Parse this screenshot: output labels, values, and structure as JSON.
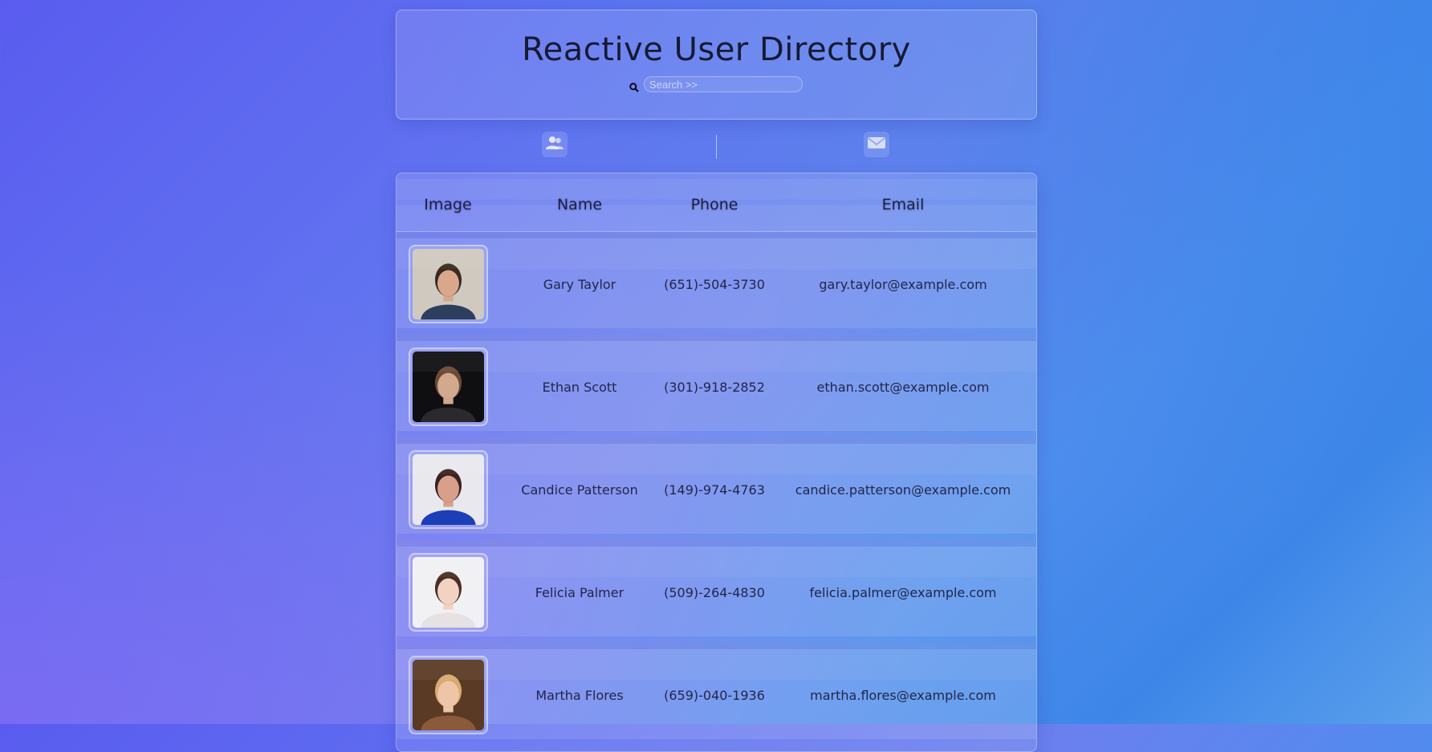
{
  "header": {
    "title": "Reactive User Directory",
    "search_placeholder": "Search >>"
  },
  "icons": {
    "search": "search-icon",
    "users": "users-icon",
    "mail": "mail-icon"
  },
  "table": {
    "columns": [
      "Image",
      "Name",
      "Phone",
      "Email"
    ],
    "rows": [
      {
        "name": "Gary Taylor",
        "phone": "(651)-504-3730",
        "email": "gary.taylor@example.com",
        "avatar_colors": [
          "#cfc9bf",
          "#3a2a22",
          "#d9a88c",
          "#2e3f5e"
        ]
      },
      {
        "name": "Ethan Scott",
        "phone": "(301)-918-2852",
        "email": "ethan.scott@example.com",
        "avatar_colors": [
          "#0f0f12",
          "#6b4a35",
          "#d2a98f",
          "#2a2a2e"
        ]
      },
      {
        "name": "Candice Patterson",
        "phone": "(149)-974-4763",
        "email": "candice.patterson@example.com",
        "avatar_colors": [
          "#e9e8ee",
          "#3a2220",
          "#d8a08a",
          "#1c3fb8"
        ]
      },
      {
        "name": "Felicia Palmer",
        "phone": "(509)-264-4830",
        "email": "felicia.palmer@example.com",
        "avatar_colors": [
          "#f1f1f4",
          "#4a2e25",
          "#f2d2c3",
          "#e6e2e4"
        ]
      },
      {
        "name": "Martha Flores",
        "phone": "(659)-040-1936",
        "email": "martha.flores@example.com",
        "avatar_colors": [
          "#5a3a25",
          "#d7ab6f",
          "#efc5a8",
          "#8a5a3a"
        ]
      }
    ]
  },
  "colors": {
    "bg_start": "#5a5cef",
    "bg_end": "#3d86e8",
    "text": "#1c1f3b"
  }
}
